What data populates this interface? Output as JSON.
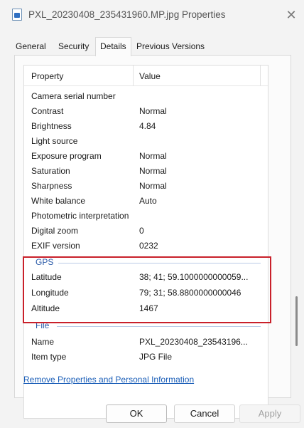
{
  "window": {
    "title": "PXL_20230408_235431960.MP.jpg Properties",
    "close_glyph": "✕",
    "icon": "file-image-icon"
  },
  "tabs": [
    {
      "label": "General"
    },
    {
      "label": "Security"
    },
    {
      "label": "Details",
      "active": true
    },
    {
      "label": "Previous Versions"
    }
  ],
  "list": {
    "headers": {
      "property": "Property",
      "value": "Value"
    },
    "rows": [
      {
        "property": "Camera serial number",
        "value": ""
      },
      {
        "property": "Contrast",
        "value": "Normal"
      },
      {
        "property": "Brightness",
        "value": "4.84"
      },
      {
        "property": "Light source",
        "value": ""
      },
      {
        "property": "Exposure program",
        "value": "Normal"
      },
      {
        "property": "Saturation",
        "value": "Normal"
      },
      {
        "property": "Sharpness",
        "value": "Normal"
      },
      {
        "property": "White balance",
        "value": "Auto"
      },
      {
        "property": "Photometric interpretation",
        "value": ""
      },
      {
        "property": "Digital zoom",
        "value": "0"
      },
      {
        "property": "EXIF version",
        "value": "0232"
      }
    ],
    "gps": {
      "label": "GPS",
      "rows": [
        {
          "property": "Latitude",
          "value": "38; 41; 59.1000000000059..."
        },
        {
          "property": "Longitude",
          "value": "79; 31; 58.8800000000046"
        },
        {
          "property": "Altitude",
          "value": "1467"
        }
      ]
    },
    "file": {
      "label": "File",
      "rows": [
        {
          "property": "Name",
          "value": "PXL_20230408_23543196..."
        },
        {
          "property": "Item type",
          "value": "JPG File"
        }
      ]
    }
  },
  "remove_link": "Remove Properties and Personal Information",
  "buttons": {
    "ok": "OK",
    "cancel": "Cancel",
    "apply": "Apply"
  },
  "colors": {
    "highlight": "#c9202a",
    "link": "#1c5fb8",
    "group_label": "#2a5aa8"
  }
}
